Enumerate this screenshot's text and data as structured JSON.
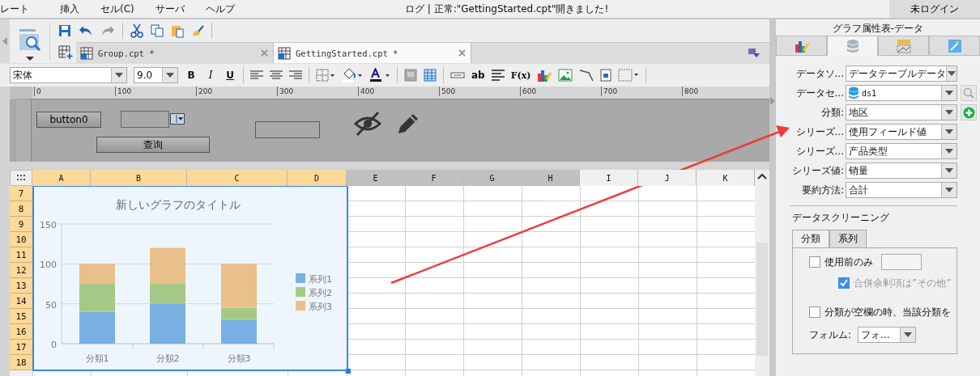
{
  "menu": [
    {
      "label": "レート"
    },
    {
      "label": "挿入"
    },
    {
      "label": "セル(C)"
    },
    {
      "label": "サーバ"
    },
    {
      "label": "ヘルプ"
    }
  ],
  "status": "ログ | 正常:\"GettingStarted.cpt\"開きました!",
  "login_button": "未ログイン",
  "document_tabs": [
    {
      "label": "Group.cpt *",
      "selected": false
    },
    {
      "label": "GettingStarted.cpt *",
      "selected": true
    }
  ],
  "format_toolbar": {
    "font": "宋体",
    "size": "9.0",
    "style_buttons": [
      "B",
      "I",
      "U"
    ],
    "text_buttons": [
      "ab",
      "F(x)"
    ]
  },
  "ruler": [
    "0",
    "100",
    "200",
    "300",
    "400",
    "500",
    "600",
    "700",
    "800"
  ],
  "form_widgets": {
    "button": "button0",
    "query_button": "查询"
  },
  "sheet": {
    "columns": [
      {
        "label": "A",
        "selected": true,
        "shaded": false
      },
      {
        "label": "B",
        "selected": true,
        "shaded": false
      },
      {
        "label": "C",
        "selected": true,
        "shaded": false
      },
      {
        "label": "D",
        "selected": true,
        "shaded": false
      },
      {
        "label": "E",
        "selected": false,
        "shaded": true
      },
      {
        "label": "F",
        "selected": false,
        "shaded": true
      },
      {
        "label": "G",
        "selected": false,
        "shaded": true
      },
      {
        "label": "H",
        "selected": false,
        "shaded": true
      },
      {
        "label": "I",
        "selected": false,
        "shaded": false
      },
      {
        "label": "J",
        "selected": false,
        "shaded": false
      },
      {
        "label": "K",
        "selected": false,
        "shaded": false
      }
    ],
    "rows": [
      {
        "label": "7",
        "selected": true
      },
      {
        "label": "8",
        "selected": true
      },
      {
        "label": "9",
        "selected": true
      },
      {
        "label": "10",
        "selected": true
      },
      {
        "label": "11",
        "selected": true
      },
      {
        "label": "12",
        "selected": true
      },
      {
        "label": "13",
        "selected": true
      },
      {
        "label": "14",
        "selected": true
      },
      {
        "label": "15",
        "selected": true
      },
      {
        "label": "16",
        "selected": true
      },
      {
        "label": "17",
        "selected": true
      },
      {
        "label": "18",
        "selected": true
      }
    ]
  },
  "chart": {
    "chart_data": {
      "type": "bar",
      "title": "新しいグラフのタイトル",
      "stacked": true,
      "legend": true,
      "categories": [
        "分類1",
        "分類2",
        "分類3"
      ],
      "ylim": [
        0,
        150
      ],
      "yticks": [
        0,
        50,
        100,
        150
      ],
      "series": [
        {
          "name": "系列1",
          "color": "#78b0e3",
          "values": [
            40,
            50,
            30
          ]
        },
        {
          "name": "系列2",
          "color": "#a6c987",
          "values": [
            35,
            25,
            15
          ]
        },
        {
          "name": "系列3",
          "color": "#e9c089",
          "values": [
            25,
            45,
            55
          ]
        }
      ]
    }
  },
  "properties": {
    "title": "グラフ属性表-データ",
    "tabs": [
      {
        "kind": "style",
        "selected": false
      },
      {
        "kind": "data",
        "selected": true
      },
      {
        "kind": "label",
        "selected": false
      },
      {
        "kind": "effect",
        "selected": false
      }
    ],
    "fields": [
      {
        "label": "データソ...",
        "value": "データテーブルデータ",
        "kind": "select"
      },
      {
        "label": "データセ...",
        "value": "ds1",
        "kind": "dataset"
      },
      {
        "label": "分類:",
        "value": "地区",
        "kind": "select-add"
      },
      {
        "label": "シリーズ...",
        "value": "使用フィールド値",
        "kind": "select"
      },
      {
        "label": "シリーズ...",
        "value": "产品类型",
        "kind": "select"
      },
      {
        "label": "シリーズ値:",
        "value": "销量",
        "kind": "select"
      },
      {
        "label": "要約方法:",
        "value": "合計",
        "kind": "select"
      }
    ]
  },
  "screening": {
    "title": "データスクリーニング",
    "tabs": [
      {
        "label": "分類",
        "selected": true
      },
      {
        "label": "系列",
        "selected": false
      }
    ],
    "options": [
      {
        "label": "使用前のみ",
        "checked": false,
        "disabled": false,
        "has_input": true,
        "children": [
          {
            "label": "合併余剰項は”その他”",
            "checked": true,
            "disabled": true
          }
        ]
      },
      {
        "label": "分類が空欄の時、当該分類を",
        "checked": false,
        "disabled": false,
        "has_input": false
      }
    ],
    "format": {
      "label": "フォルム:",
      "value": "フォ..."
    }
  }
}
